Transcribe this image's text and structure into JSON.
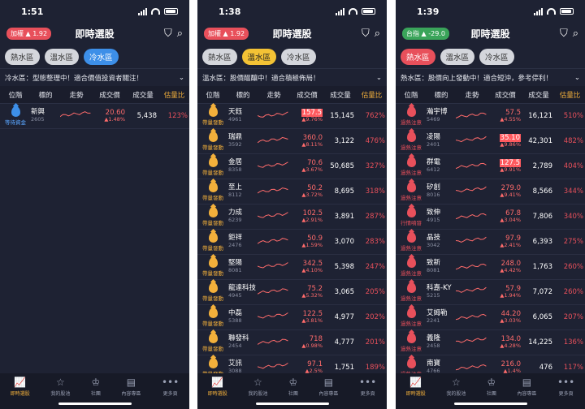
{
  "screens": [
    {
      "time": "1:51",
      "index": {
        "label": "加權",
        "arrow": "▲",
        "value": "1.92",
        "color": "red"
      },
      "title": "即時選股",
      "zones": [
        "熱水區",
        "溫水區",
        "冷水區"
      ],
      "active_zone": 2,
      "active_color": "blue",
      "banner": "冷水區：型態整理中！適合價值投資者關注！",
      "columns": [
        "位階",
        "標的",
        "走勢",
        "成交價",
        "成交量",
        "估量比"
      ],
      "rows": [
        {
          "level": "等待資金",
          "level_color": "b",
          "name": "新興",
          "code": "2605",
          "price": "20.60",
          "change": "▲1.48%",
          "volume": "5,438",
          "ratio": "123%",
          "boxed": false
        }
      ]
    },
    {
      "time": "1:38",
      "index": {
        "label": "加權",
        "arrow": "▲",
        "value": "1.92",
        "color": "red"
      },
      "title": "即時選股",
      "zones": [
        "熱水區",
        "溫水區",
        "冷水區"
      ],
      "active_zone": 1,
      "active_color": "yellow",
      "banner": "溫水區：股價醞釀中！適合積極佈局！",
      "columns": [
        "位階",
        "標的",
        "走勢",
        "成交價",
        "成交量",
        "估量比"
      ],
      "rows": [
        {
          "level": "帶量發動",
          "level_color": "y",
          "name": "天鈺",
          "code": "4961",
          "price": "157.5",
          "change": "▲9.76%",
          "volume": "15,145",
          "ratio": "762%",
          "boxed": true
        },
        {
          "level": "帶量發動",
          "level_color": "y",
          "name": "瑞鼎",
          "code": "3592",
          "price": "360.0",
          "change": "▲8.11%",
          "volume": "3,122",
          "ratio": "476%",
          "boxed": false
        },
        {
          "level": "帶量發動",
          "level_color": "y",
          "name": "金居",
          "code": "8358",
          "price": "70.6",
          "change": "▲3.67%",
          "volume": "50,685",
          "ratio": "327%",
          "boxed": false
        },
        {
          "level": "帶量發動",
          "level_color": "y",
          "name": "至上",
          "code": "8112",
          "price": "50.2",
          "change": "▲3.72%",
          "volume": "8,695",
          "ratio": "318%",
          "boxed": false
        },
        {
          "level": "帶量發動",
          "level_color": "y",
          "name": "力成",
          "code": "6239",
          "price": "102.5",
          "change": "▲2.91%",
          "volume": "3,891",
          "ratio": "287%",
          "boxed": false
        },
        {
          "level": "帶量發動",
          "level_color": "y",
          "name": "鉅祥",
          "code": "2476",
          "price": "50.9",
          "change": "▲1.59%",
          "volume": "3,070",
          "ratio": "283%",
          "boxed": false
        },
        {
          "level": "帶量發動",
          "level_color": "y",
          "name": "堅陽",
          "code": "8081",
          "price": "342.5",
          "change": "▲4.10%",
          "volume": "5,398",
          "ratio": "247%",
          "boxed": false
        },
        {
          "level": "帶量發動",
          "level_color": "y",
          "name": "龍達科技",
          "code": "4945",
          "price": "75.2",
          "change": "▲5.32%",
          "volume": "3,065",
          "ratio": "205%",
          "boxed": false
        },
        {
          "level": "帶量發動",
          "level_color": "y",
          "name": "中磊",
          "code": "5388",
          "price": "122.5",
          "change": "▲3.81%",
          "volume": "4,977",
          "ratio": "202%",
          "boxed": false
        },
        {
          "level": "帶量發動",
          "level_color": "y",
          "name": "聯發科",
          "code": "2454",
          "price": "718",
          "change": "▲0.98%",
          "volume": "4,777",
          "ratio": "201%",
          "boxed": false
        },
        {
          "level": "帶量發動",
          "level_color": "y",
          "name": "艾訊",
          "code": "3088",
          "price": "97.1",
          "change": "▲2.5%",
          "volume": "1,751",
          "ratio": "189%",
          "boxed": false
        }
      ]
    },
    {
      "time": "1:39",
      "index": {
        "label": "台指",
        "arrow": "▲",
        "value": "-29.0",
        "color": "green"
      },
      "title": "即時選股",
      "zones": [
        "熱水區",
        "溫水區",
        "冷水區"
      ],
      "active_zone": 0,
      "active_color": "red",
      "banner": "熱水區：股價向上發動中！適合短沖，參考停利！",
      "columns": [
        "位階",
        "標的",
        "走勢",
        "成交價",
        "成交量",
        "估量比"
      ],
      "rows": [
        {
          "level": "過熱注意",
          "level_color": "r",
          "name": "瀚宇博",
          "code": "5469",
          "price": "57.5",
          "change": "▲4.55%",
          "volume": "16,121",
          "ratio": "510%",
          "boxed": false
        },
        {
          "level": "過熱注意",
          "level_color": "r",
          "name": "凌陽",
          "code": "2401",
          "price": "35.10",
          "change": "▲9.86%",
          "volume": "42,301",
          "ratio": "482%",
          "boxed": true
        },
        {
          "level": "過熱注意",
          "level_color": "r",
          "name": "群電",
          "code": "6412",
          "price": "127.5",
          "change": "▲9.91%",
          "volume": "2,789",
          "ratio": "404%",
          "boxed": true
        },
        {
          "level": "過熱注意",
          "level_color": "r",
          "name": "矽創",
          "code": "8016",
          "price": "279.0",
          "change": "▲9.41%",
          "volume": "8,566",
          "ratio": "344%",
          "boxed": false
        },
        {
          "level": "行情噴發",
          "level_color": "r",
          "name": "致伸",
          "code": "4915",
          "price": "67.8",
          "change": "▲3.04%",
          "volume": "7,806",
          "ratio": "340%",
          "boxed": false
        },
        {
          "level": "過熱注意",
          "level_color": "r",
          "name": "晶技",
          "code": "3042",
          "price": "97.9",
          "change": "▲2.41%",
          "volume": "6,393",
          "ratio": "275%",
          "boxed": false
        },
        {
          "level": "過熱注意",
          "level_color": "r",
          "name": "致新",
          "code": "8081",
          "price": "248.0",
          "change": "▲4.42%",
          "volume": "1,763",
          "ratio": "260%",
          "boxed": false
        },
        {
          "level": "過熱注意",
          "level_color": "r",
          "name": "科嘉-KY",
          "code": "5215",
          "price": "57.9",
          "change": "▲1.94%",
          "volume": "7,072",
          "ratio": "260%",
          "boxed": false
        },
        {
          "level": "過熱注意",
          "level_color": "r",
          "name": "艾姆勒",
          "code": "2241",
          "price": "44.20",
          "change": "▲3.03%",
          "volume": "6,065",
          "ratio": "207%",
          "boxed": false
        },
        {
          "level": "過熱注意",
          "level_color": "r",
          "name": "義隆",
          "code": "2458",
          "price": "134.0",
          "change": "▲4.28%",
          "volume": "14,225",
          "ratio": "136%",
          "boxed": false
        },
        {
          "level": "過熱注意",
          "level_color": "r",
          "name": "南寶",
          "code": "4766",
          "price": "216.0",
          "change": "▲1.4%",
          "volume": "476",
          "ratio": "117%",
          "boxed": false
        }
      ]
    }
  ],
  "nav": [
    {
      "label": "即時選股",
      "icon": "chart-icon",
      "glyph": "📈"
    },
    {
      "label": "我的股池",
      "icon": "star-icon",
      "glyph": "☆"
    },
    {
      "label": "社團",
      "icon": "crown-icon",
      "glyph": "♔"
    },
    {
      "label": "內容專區",
      "icon": "document-icon",
      "glyph": "▤"
    },
    {
      "label": "更多頁",
      "icon": "more-icon",
      "glyph": "•••"
    }
  ],
  "colors": {
    "background": "#1e2233",
    "up": "#ff6b6b",
    "accent": "#f3b03b",
    "cold": "#3d8fe8"
  }
}
